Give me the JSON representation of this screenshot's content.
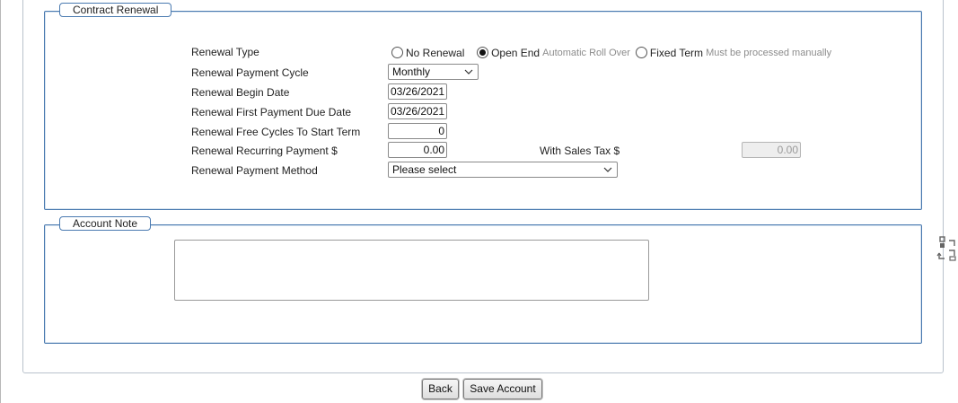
{
  "contract_renewal": {
    "legend": "Contract Renewal",
    "renewal_type": {
      "label": "Renewal Type",
      "options": [
        {
          "label": "No Renewal",
          "hint": "",
          "selected": false
        },
        {
          "label": "Open End",
          "hint": "Automatic Roll Over",
          "selected": true
        },
        {
          "label": "Fixed Term",
          "hint": "Must be processed manually",
          "selected": false
        }
      ]
    },
    "payment_cycle": {
      "label": "Renewal Payment Cycle",
      "value": "Monthly"
    },
    "begin_date": {
      "label": "Renewal Begin Date",
      "value": "03/26/2021"
    },
    "first_due_date": {
      "label": "Renewal First Payment Due Date",
      "value": "03/26/2021"
    },
    "free_cycles": {
      "label": "Renewal Free Cycles To Start Term",
      "value": "0"
    },
    "recurring_payment": {
      "label": "Renewal Recurring Payment $",
      "value": "0.00"
    },
    "sales_tax": {
      "label": "With Sales Tax $",
      "value": "0.00"
    },
    "payment_method": {
      "label": "Renewal Payment Method",
      "value": "Please select"
    }
  },
  "account_note": {
    "legend": "Account Note",
    "value": ""
  },
  "buttons": {
    "back": "Back",
    "save": "Save Account"
  },
  "icons": {
    "side_tool": "flow-arrows-icon",
    "select_chevron": "chevron-down-icon"
  }
}
